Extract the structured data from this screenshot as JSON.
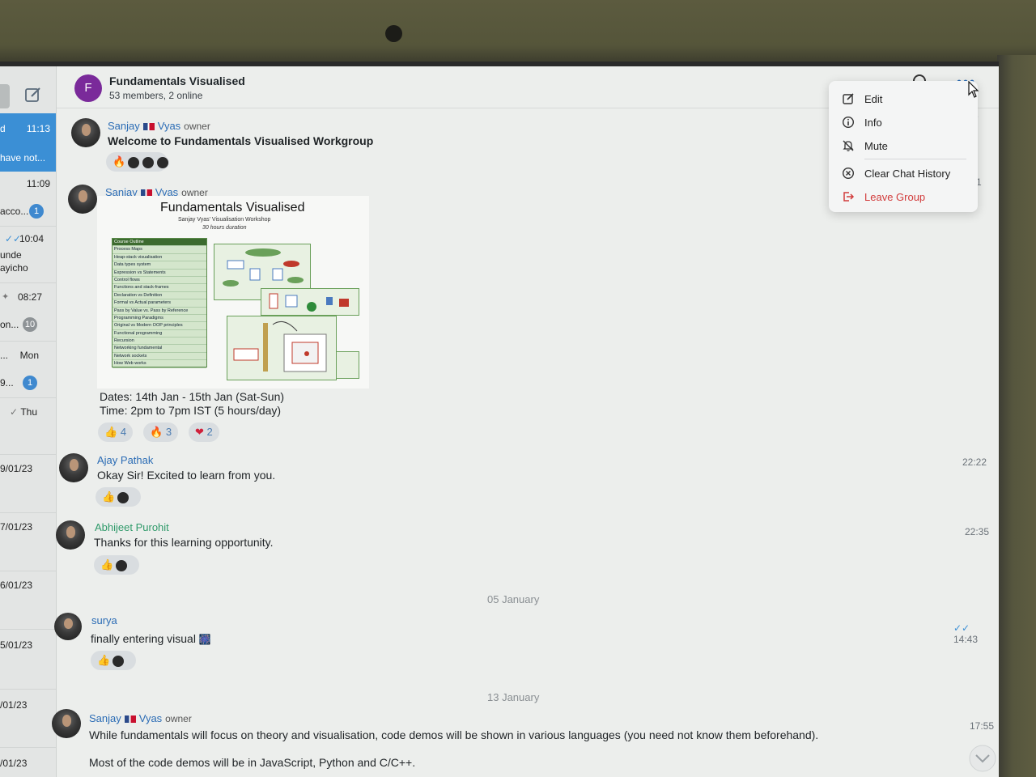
{
  "header": {
    "group_initial": "F",
    "group_name": "Fundamentals Visualised",
    "members": "53 members, 2 online"
  },
  "sidebar": {
    "items": [
      {
        "text": "d",
        "time": "11:13"
      },
      {
        "text": "have not..."
      },
      {
        "time": "11:09"
      },
      {
        "text": "acco...",
        "badge": "1"
      },
      {
        "time": "10:04"
      },
      {
        "text": "unde"
      },
      {
        "text": "ayicho"
      },
      {
        "time": "08:27"
      },
      {
        "text": "on...",
        "badge": "10"
      },
      {
        "text": "...",
        "time": "Mon"
      },
      {
        "text": "9...",
        "badge": "1"
      },
      {
        "time": "Thu"
      },
      {
        "text": "9/01/23"
      },
      {
        "text": "7/01/23"
      },
      {
        "text": "6/01/23"
      },
      {
        "text": "5/01/23"
      },
      {
        "text": "/01/23"
      },
      {
        "text": "/01/23"
      }
    ]
  },
  "messages": {
    "m1": {
      "first_name": "Sanjay",
      "last_name": "Vyas",
      "role": "owner",
      "text": "Welcome to Fundamentals Visualised Workgroup"
    },
    "m2": {
      "first_name": "Sanjay",
      "last_name": "Vyas",
      "role": "owner",
      "poster_title": "Fundamentals Visualised",
      "poster_sub": "Sanjay Vyas' Visualisation Workshop",
      "poster_sub2": "30 hours duration",
      "outline": [
        "Course Outline",
        "Process Maps",
        "Heap-stack visualisation",
        "Data types system",
        "Expression vs Statements",
        "Control flows",
        "Functions and stack-frames",
        "Declaration vs Definition",
        "Formal vs Actual parameters",
        "Pass by Value vs. Pass by Reference",
        "Programming Paradigms",
        "Original vs Modern OOP principles",
        "Functional programming",
        "Recursion",
        "Networking fundamental",
        "Network sockets",
        "How Web works"
      ],
      "dates": "Dates: 14th Jan - 15th Jan (Sat-Sun)",
      "time_line": "Time:  2pm to 7pm IST (5 hours/day)",
      "reactions": [
        {
          "emoji": "👍",
          "count": "4"
        },
        {
          "emoji": "🔥",
          "count": "3"
        },
        {
          "emoji": "❤",
          "count": "2"
        }
      ]
    },
    "m3": {
      "name": "Ajay Pathak",
      "text": "Okay Sir! Excited to learn from you.",
      "time": "22:22"
    },
    "m4": {
      "name": "Abhijeet Purohit",
      "text": "Thanks for this learning opportunity.",
      "time": "22:35"
    },
    "sep1": "05 January",
    "m5": {
      "name": "surya",
      "text": "finally entering visual",
      "time": "14:43"
    },
    "sep2": "13 January",
    "m6": {
      "first_name": "Sanjay",
      "last_name": "Vyas",
      "role": "owner",
      "text1": "While fundamentals will focus on theory and visualisation, code demos will be shown in various languages (you need not know them beforehand).",
      "text2": "Most of the code demos will be in JavaScript, Python and C/C++.",
      "time": "17:55"
    }
  },
  "menu": {
    "edit": "Edit",
    "info": "Info",
    "mute": "Mute",
    "clear": "Clear Chat History",
    "leave": "Leave Group"
  },
  "edge_digits": {
    "a": "6",
    "b": "1"
  },
  "colors": {
    "accent": "#3b8fd5",
    "group_avatar": "#7a2a9a",
    "danger": "#d23c3c",
    "name_blue": "#2b6cb5",
    "name_green": "#2f9a6a"
  }
}
